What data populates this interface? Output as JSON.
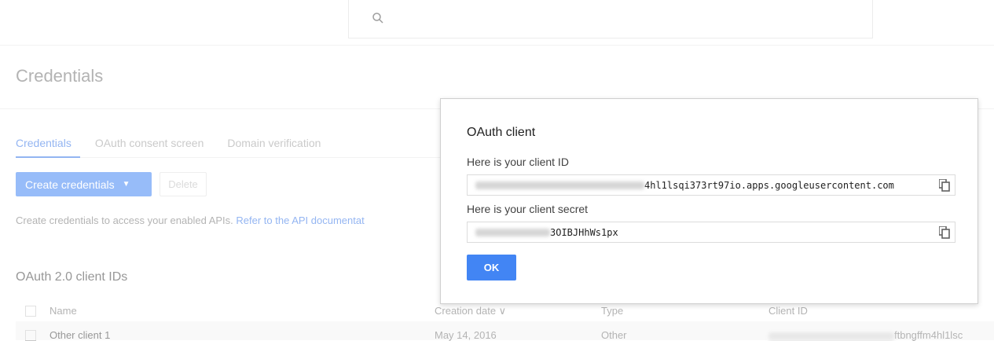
{
  "search": {
    "placeholder": ""
  },
  "page": {
    "title": "Credentials"
  },
  "tabs": [
    {
      "label": "Credentials",
      "active": true
    },
    {
      "label": "OAuth consent screen",
      "active": false
    },
    {
      "label": "Domain verification",
      "active": false
    }
  ],
  "toolbar": {
    "create_label": "Create credentials",
    "create_caret": "▼",
    "delete_label": "Delete"
  },
  "help": {
    "text": "Create credentials to access your enabled APIs. ",
    "link": "Refer to the API documentat"
  },
  "section": {
    "title": "OAuth 2.0 client IDs"
  },
  "table": {
    "columns": [
      "Name",
      "Creation date ∨",
      "Type",
      "Client ID"
    ],
    "rows": [
      {
        "name": "Other client 1",
        "date": "May 14, 2016",
        "type": "Other",
        "client_id_visible": "ftbngffm4hl1lsc"
      }
    ]
  },
  "dialog": {
    "title": "OAuth client",
    "client_id_label": "Here is your client ID",
    "client_id_visible": "4hl1lsqi373rt97io.apps.googleusercontent.com",
    "client_secret_label": "Here is your client secret",
    "client_secret_visible": "3OIBJHhWs1px",
    "ok_label": "OK"
  },
  "colors": {
    "accent": "#4285f4",
    "link": "#3b78e7"
  }
}
